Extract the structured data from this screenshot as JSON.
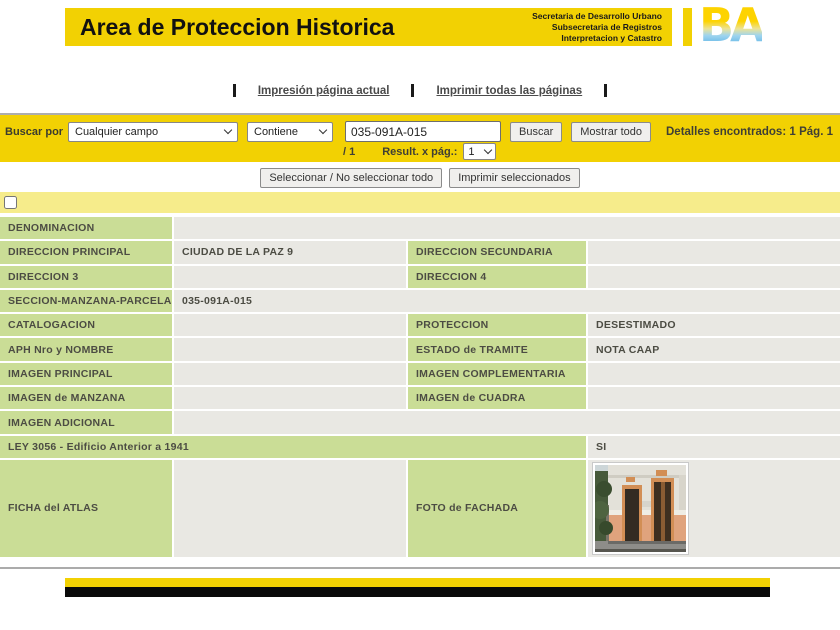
{
  "header": {
    "title": "Area de Proteccion Historica",
    "secretaria_line1": "Secretaria de Desarrollo Urbano",
    "secretaria_line2": "Subsecretaria de Registros",
    "secretaria_line3": "Interpretacion y Catastro",
    "logo_text": "BA",
    "accent_yellow": "#f2d103"
  },
  "print_links": {
    "print_current": "Impresión página actual",
    "print_all": "Imprimir todas las páginas"
  },
  "search": {
    "label": "Buscar por",
    "field_select_value": "Cualquier campo",
    "operator_select_value": "Contiene",
    "query_value": "035-091A-015",
    "buscar_button": "Buscar",
    "mostrar_todo_button": "Mostrar todo",
    "results_text": "Detalles encontrados: 1",
    "page_text": "Pág. 1",
    "page_fraction": "/ 1",
    "per_page_label": "Result. x pág.:",
    "per_page_value": "1"
  },
  "actions": {
    "select_all_button": "Seleccionar / No seleccionar todo",
    "print_selected_button": "Imprimir seleccionados"
  },
  "table": {
    "label_bg": "#cadd96",
    "value_bg": "#e9e8e3",
    "rows": [
      {
        "label1": "DENOMINACION",
        "value1": ""
      },
      {
        "label1": "DIRECCION PRINCIPAL",
        "value1": "CIUDAD DE LA PAZ 9",
        "label2": "DIRECCION SECUNDARIA",
        "value2": ""
      },
      {
        "label1": "DIRECCION 3",
        "value1": "",
        "label2": "DIRECCION 4",
        "value2": ""
      },
      {
        "label1": "SECCION-MANZANA-PARCELA",
        "value1": "035-091A-015"
      },
      {
        "label1": "CATALOGACION",
        "value1": "",
        "label2": "PROTECCION",
        "value2": "DESESTIMADO"
      },
      {
        "label1": "APH Nro y NOMBRE",
        "value1": "",
        "label2": "ESTADO de TRAMITE",
        "value2": "NOTA CAAP"
      },
      {
        "label1": "IMAGEN PRINCIPAL",
        "value1": "",
        "label2": "IMAGEN COMPLEMENTARIA",
        "value2": ""
      },
      {
        "label1": "IMAGEN de MANZANA",
        "value1": "",
        "label2": "IMAGEN de CUADRA",
        "value2": ""
      },
      {
        "label1": "IMAGEN ADICIONAL",
        "value1": ""
      },
      {
        "label1": "LEY 3056 - Edificio Anterior a 1941",
        "value1": "SI"
      },
      {
        "label1": "FICHA del ATLAS",
        "value1": "",
        "label2": "FOTO de FACHADA"
      }
    ]
  }
}
